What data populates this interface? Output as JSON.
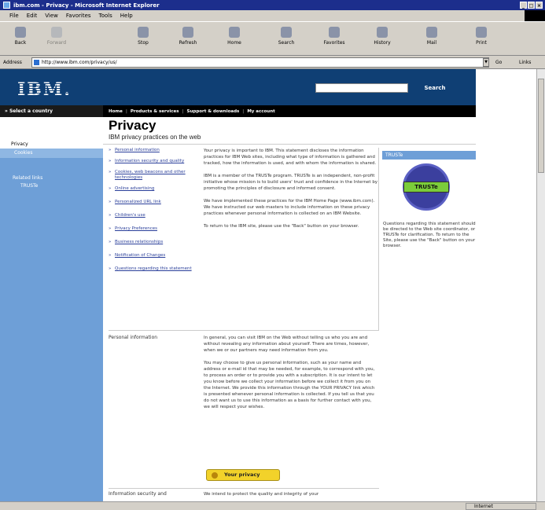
{
  "window": {
    "title": "ibm.com - Privacy - Microsoft Internet Explorer"
  },
  "menu": [
    "File",
    "Edit",
    "View",
    "Favorites",
    "Tools",
    "Help"
  ],
  "toolbar": [
    "Back",
    "Forward",
    "Stop",
    "Refresh",
    "Home",
    "Search",
    "Favorites",
    "History",
    "Mail",
    "Print"
  ],
  "address": {
    "label": "Address",
    "url": "http://www.ibm.com/privacy/us/",
    "go": "Go",
    "links": "Links"
  },
  "site": {
    "logo": "IBM.",
    "search_label": "Search",
    "country": "» Select a country",
    "nav": [
      "Home",
      "Products & services",
      "Support & downloads",
      "My account"
    ]
  },
  "sidebar": {
    "items": [
      "Privacy",
      "Cookies"
    ],
    "related": [
      "Related links",
      "TRUSTe"
    ]
  },
  "page": {
    "title": "Privacy",
    "subtitle": "IBM privacy practices on the web",
    "toc": [
      "Personal information",
      "Information security and quality",
      "Cookies, web beacons and other technologies",
      "Online advertising",
      "Personalized URL link",
      "Children's use",
      "Privacy Preferences",
      "Business relationships",
      "Notification of Changes",
      "Questions regarding this statement"
    ],
    "intro_p1": "Your privacy is important to IBM. This statement discloses the information practices for IBM Web sites, including what type of information is gathered and tracked, how the information is used, and with whom the information is shared.",
    "intro_p2": "IBM is a member of the TRUSTe program. TRUSTe is an independent, non-profit initiative whose mission is to build users' trust and confidence in the Internet by promoting the principles of disclosure and informed consent.",
    "intro_p3": "We have implemented these practices for the IBM Home Page (www.ibm.com). We have instructed our web masters to include information on these privacy practices whenever personal information is collected on an IBM Website.",
    "intro_p4": "To return to the IBM site, please use the \"Back\" button on your browser.",
    "section1_label": "Personal information",
    "personal_p1": "In general, you can visit IBM on the Web without telling us who you are and without revealing any information about yourself. There are times, however, when we or our partners may need information from you.",
    "personal_p2": "You may choose to give us personal information, such as your name and address or e-mail id that may be needed, for example, to correspond with you, to process an order or to provide you with a subscription. It is our intent to let you know before we collect your information before we collect it from you on the Internet. We provide this information through the YOUR PRIVACY link which is presented whenever personal information is collected. If you tell us that you do not want us to use this information as a basis for further contact with you, we will respect your wishes.",
    "your_privacy_btn": "Your privacy",
    "section2_label": "Information security and",
    "security_p1": "We intend to protect the quality and integrity of your"
  },
  "truste": {
    "heading": "TRUSTe",
    "seal": "TRUSTe",
    "text": "Questions regarding this statement should be directed to the Web site coordinator, or TRUSTe for clarification. To return to the Site, please use the \"Back\" button on your browser."
  },
  "status": {
    "zone": "Internet"
  }
}
